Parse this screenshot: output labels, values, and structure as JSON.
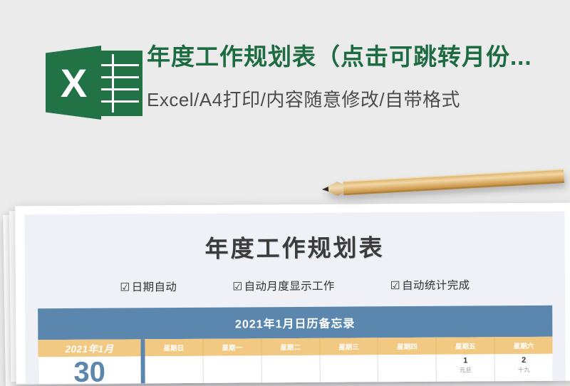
{
  "banner": {
    "logo": "excel-logo",
    "title": "年度工作规划表（点击可跳转月份...",
    "subtitle": "Excel/A4打印/内容随意修改/自带格式",
    "title_color": "#1c6b41",
    "background_color": "#ebebeb"
  },
  "decoration": {
    "pencil": "wooden-pencil"
  },
  "document": {
    "title": "年度工作规划表",
    "options": [
      {
        "checkbox": "☑",
        "label": "日期自动"
      },
      {
        "checkbox": "☑",
        "label": "自动月度显示工作"
      },
      {
        "checkbox": "☑",
        "label": "自动统计完成"
      }
    ],
    "calendar": {
      "band_title": "2021年1月日历备忘录",
      "band_color": "#5b87ae",
      "header_color": "#f2c982",
      "month_label": "2021年1月",
      "month_big_number": "30",
      "weekdays": [
        "星期日",
        "星期一",
        "星期二",
        "星期三",
        "星期四",
        "星期五",
        "星期六"
      ],
      "cells": [
        {
          "num": "",
          "lunar": ""
        },
        {
          "num": "",
          "lunar": ""
        },
        {
          "num": "",
          "lunar": ""
        },
        {
          "num": "",
          "lunar": ""
        },
        {
          "num": "",
          "lunar": ""
        },
        {
          "num": "1",
          "lunar": "元旦"
        },
        {
          "num": "2",
          "lunar": "十九"
        }
      ]
    }
  }
}
